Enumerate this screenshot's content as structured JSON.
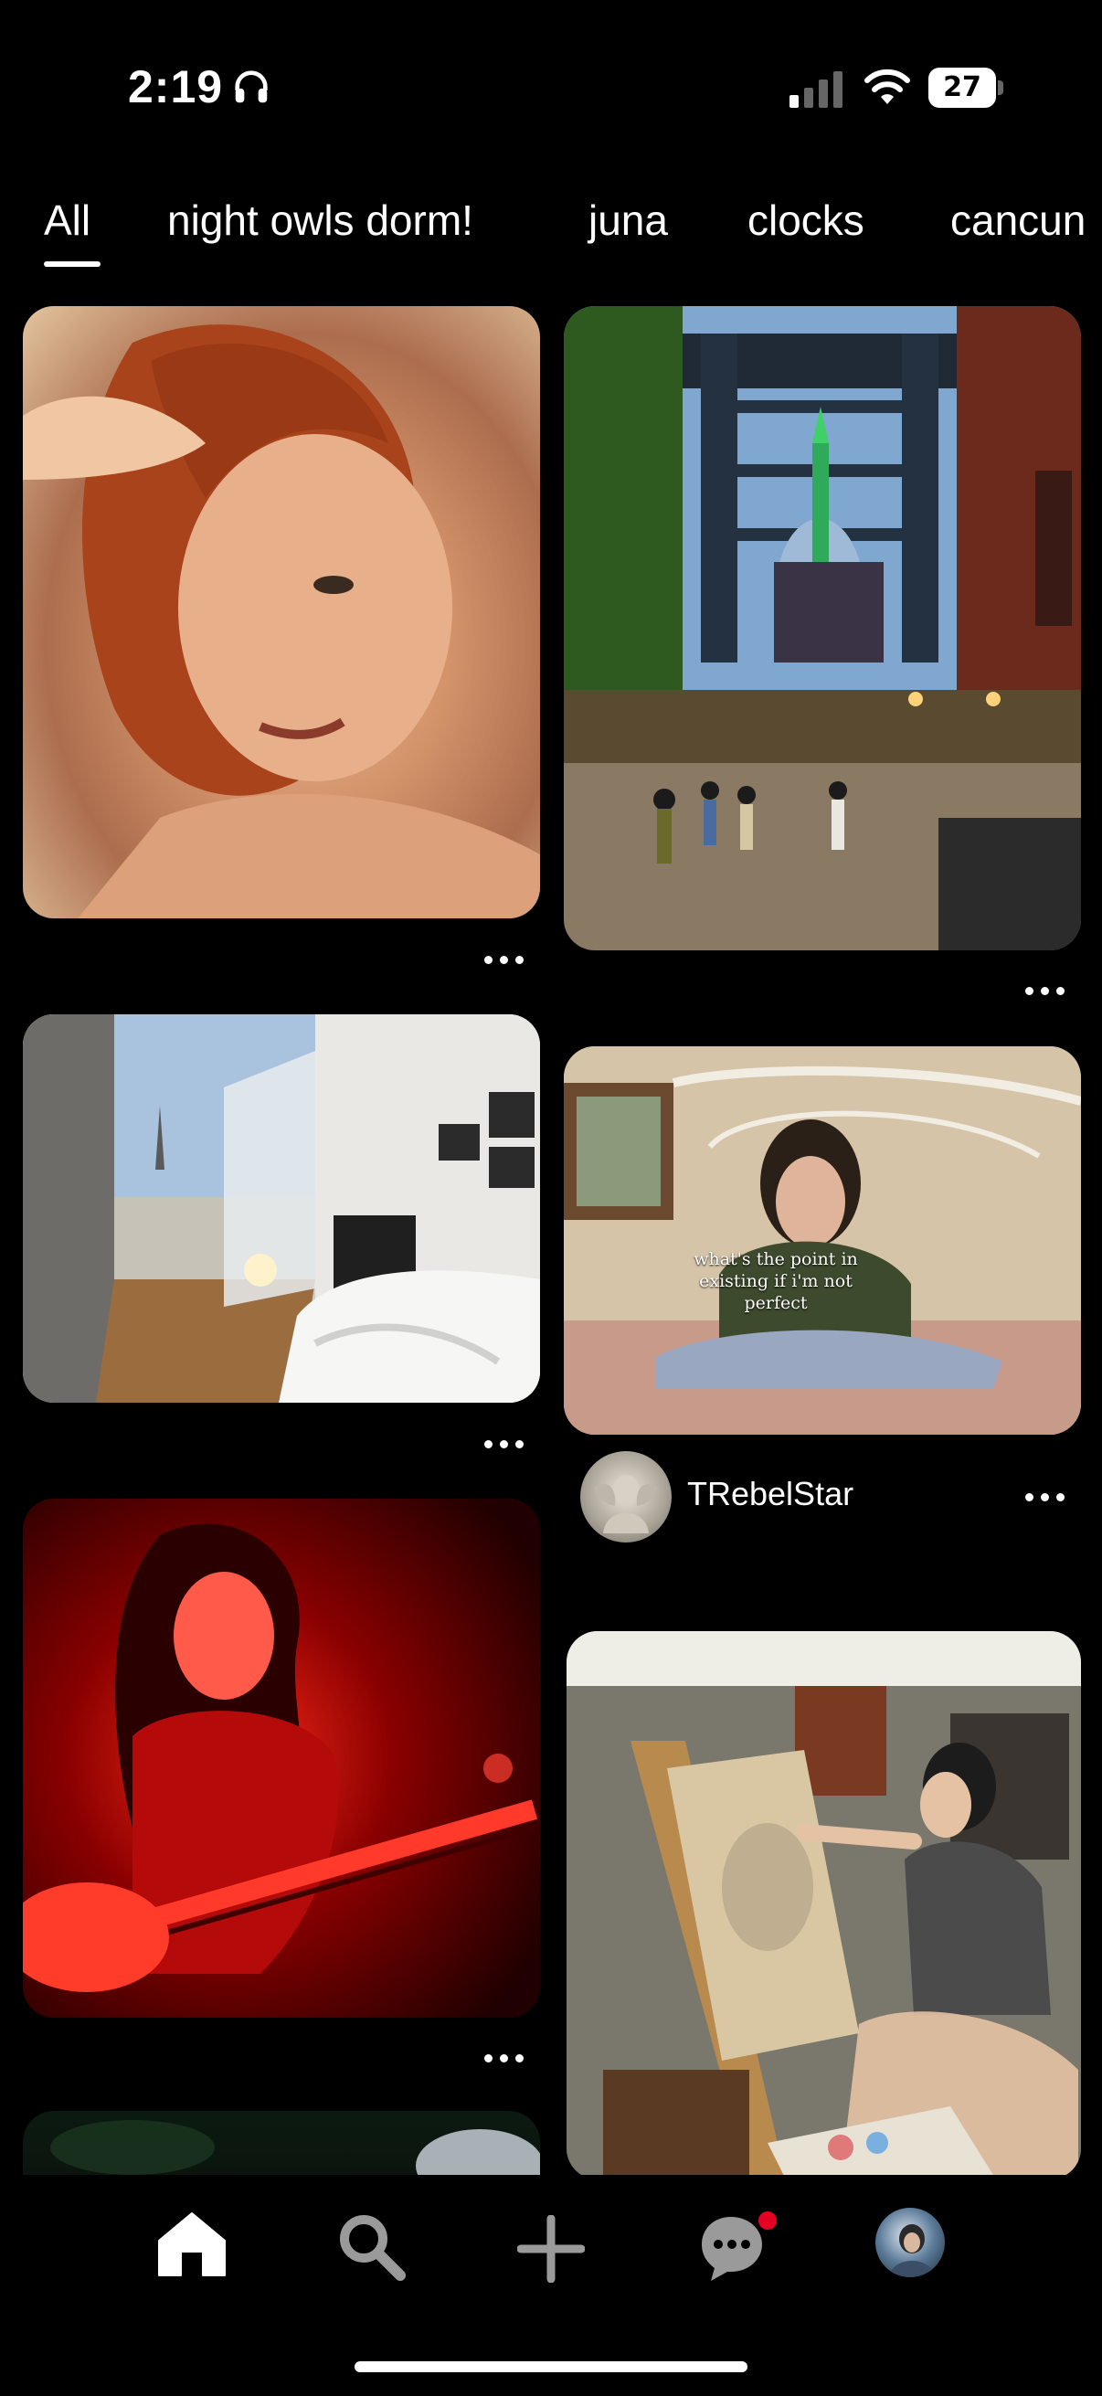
{
  "status": {
    "time": "2:19",
    "battery": "27"
  },
  "tabs": [
    "All",
    "night owls dorm!",
    "juna",
    "clocks",
    "cancun"
  ],
  "active_tab": "All",
  "pins": {
    "overlay_quote": "what's the point in existing if i'm not perfect",
    "author": "TRebelStar"
  },
  "icons": {
    "status": [
      "headphones-icon",
      "cellular-signal-icon",
      "wifi-icon",
      "battery-icon"
    ],
    "nav": [
      "home-icon",
      "search-icon",
      "create-plus-icon",
      "messages-icon",
      "profile-avatar"
    ]
  },
  "colors": {
    "background": "#000000",
    "notification_dot": "#e60023"
  }
}
